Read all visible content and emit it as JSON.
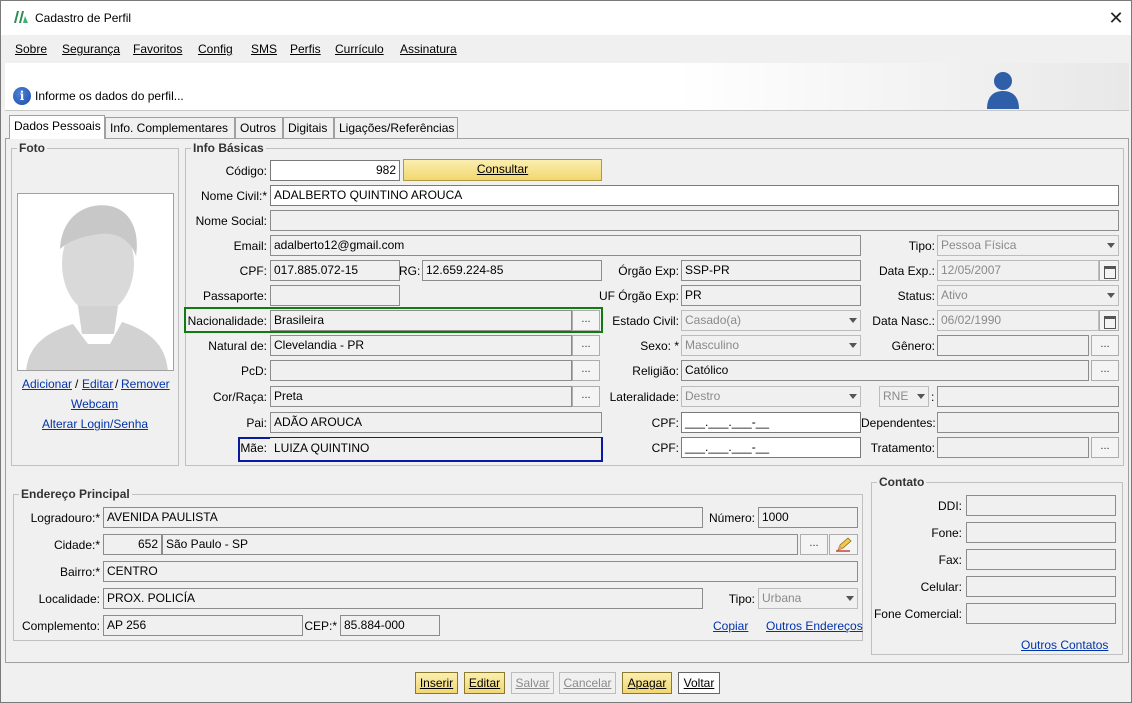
{
  "window": {
    "title": "Cadastro de Perfil",
    "close_glyph": "✕"
  },
  "menu": [
    "Sobre",
    "Segurança",
    "Favoritos",
    "Config",
    "SMS",
    "Perfis",
    "Currículo",
    "Assinatura"
  ],
  "info": {
    "message": "Informe os dados do perfil..."
  },
  "tabs": [
    "Dados Pessoais",
    "Info. Complementares",
    "Outros",
    "Digitais",
    "Ligações/Referências"
  ],
  "foto": {
    "title": "Foto",
    "add": "Adicionar",
    "sep1": "/",
    "edit": "Editar",
    "sep2": "/",
    "remove": "Remover",
    "webcam": "Webcam",
    "alter_login": "Alterar Login/Senha"
  },
  "basic": {
    "title": "Info Básicas",
    "codigo_label": "Código:",
    "codigo": "982",
    "consultar": "Consultar",
    "nome_civil_label": "Nome Civil:*",
    "nome_civil": "ADALBERTO QUINTINO AROUCA",
    "nome_social_label": "Nome Social:",
    "nome_social": "",
    "email_label": "Email:",
    "email": "adalberto12@gmail.com",
    "tipo_label": "Tipo:",
    "tipo": "Pessoa Física",
    "cpf_label": "CPF:",
    "cpf": "017.885.072-15",
    "rg_label": "RG:",
    "rg": "12.659.224-85",
    "orgao_label": "Órgão Exp:",
    "orgao": "SSP-PR",
    "data_exp_label": "Data Exp.:",
    "data_exp": "12/05/2007",
    "passaporte_label": "Passaporte:",
    "passaporte": "",
    "uf_orgao_label": "UF Órgão Exp:",
    "uf_orgao": "PR",
    "status_label": "Status:",
    "status": "Ativo",
    "nacionalidade_label": "Nacionalidade:",
    "nacionalidade": "Brasileira",
    "estado_civil_label": "Estado Civil:",
    "estado_civil": "Casado(a)",
    "data_nasc_label": "Data Nasc.:",
    "data_nasc": "06/02/1990",
    "natural_label": "Natural de:",
    "natural": "Clevelandia - PR",
    "sexo_label": "Sexo: *",
    "sexo": "Masculino",
    "genero_label": "Gênero:",
    "genero": "",
    "pcd_label": "PcD:",
    "pcd": "",
    "religiao_label": "Religião:",
    "religiao": "Católico",
    "cor_label": "Cor/Raça:",
    "cor": "Preta",
    "lateralidade_label": "Lateralidade:",
    "lateralidade": "Destro",
    "rne": "RNE",
    "rne_sep": ":",
    "rne_value": "",
    "pai_label": "Pai:",
    "pai": "ADÃO AROUCA",
    "cpf_pai_label": "CPF:",
    "cpf_pai": "___.___.___-__",
    "dependentes_label": "Dependentes:",
    "dependentes": "",
    "mae_label": "Mãe:",
    "mae": "LUIZA QUINTINO",
    "cpf_mae_label": "CPF:",
    "cpf_mae": "___.___.___-__",
    "tratamento_label": "Tratamento:",
    "tratamento": "",
    "dots": "..."
  },
  "endereco": {
    "title": "Endereço Principal",
    "logradouro_label": "Logradouro:*",
    "logradouro": "AVENIDA PAULISTA",
    "numero_label": "Número:",
    "numero": "1000",
    "cidade_label": "Cidade:*",
    "cidade_cod": "652",
    "cidade": "São Paulo - SP",
    "bairro_label": "Bairro:*",
    "bairro": "CENTRO",
    "localidade_label": "Localidade:",
    "localidade": "PROX. POLICÍA",
    "tipo_label": "Tipo:",
    "tipo": "Urbana",
    "complemento_label": "Complemento:",
    "complemento": "AP 256",
    "cep_label": "CEP:*",
    "cep": "85.884-000",
    "copiar": "Copiar",
    "outros": "Outros Endereços"
  },
  "contato": {
    "title": "Contato",
    "ddi_label": "DDI:",
    "fone_label": "Fone:",
    "fax_label": "Fax:",
    "celular_label": "Celular:",
    "comercial_label": "Fone Comercial:",
    "outros": "Outros Contatos"
  },
  "buttons": {
    "inserir": "Inserir",
    "editar": "Editar",
    "salvar": "Salvar",
    "cancelar": "Cancelar",
    "apagar": "Apagar",
    "voltar": "Voltar"
  },
  "colors": {
    "highlight_green": "#137a13",
    "highlight_blue": "#0a1aa0",
    "accent_yellow": "#f2d770",
    "link": "#0033aa"
  }
}
